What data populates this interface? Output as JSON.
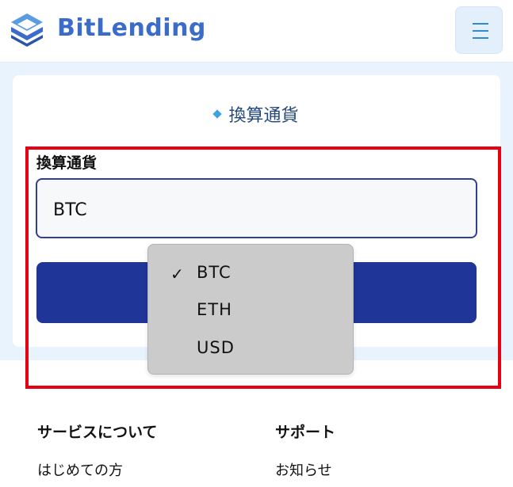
{
  "header": {
    "logo_text": "BitLending",
    "logo_icon": "bitlending-logo-icon",
    "menu_icon": "hamburger-menu-icon"
  },
  "section": {
    "title": "換算通貨",
    "title_icon": "diamond-bullet-icon"
  },
  "form": {
    "field_label": "換算通貨",
    "selected_value": "BTC"
  },
  "dropdown": {
    "check_glyph": "✓",
    "options": [
      {
        "label": "BTC",
        "selected": true
      },
      {
        "label": "ETH",
        "selected": false
      },
      {
        "label": "USD",
        "selected": false
      }
    ]
  },
  "footer": {
    "col1": {
      "heading": "サービスについて",
      "link": "はじめての方"
    },
    "col2": {
      "heading": "サポート",
      "link": "お知らせ"
    }
  },
  "colors": {
    "brand_blue": "#3b6cc9",
    "button_navy": "#1f3598",
    "band_bg": "#e9f3fd",
    "highlight_red": "#e60012"
  }
}
